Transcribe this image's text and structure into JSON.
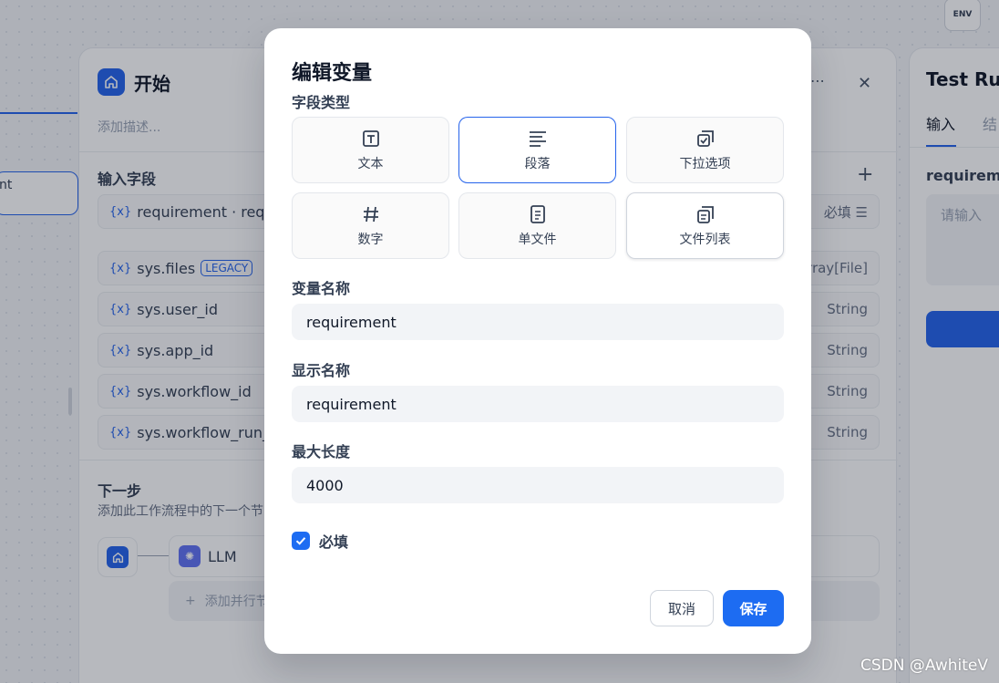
{
  "background": {
    "env_button": "ENV",
    "left_node_label": "nt",
    "start_panel": {
      "title": "开始",
      "description_placeholder": "添加描述...",
      "input_fields_label": "输入字段",
      "variables": [
        {
          "name": "requirement · requi",
          "right": "必填",
          "legacy": ""
        },
        {
          "name": "sys.files",
          "right": "rray[File]",
          "legacy": "LEGACY"
        },
        {
          "name": "sys.user_id",
          "right": "String",
          "legacy": ""
        },
        {
          "name": "sys.app_id",
          "right": "String",
          "legacy": ""
        },
        {
          "name": "sys.workflow_id",
          "right": "String",
          "legacy": ""
        },
        {
          "name": "sys.workflow_run_id",
          "right": "String",
          "legacy": ""
        }
      ],
      "variable_prefix": "{x}",
      "next_step_label": "下一步",
      "next_step_desc": "添加此工作流程中的下一个节",
      "llm_node": "LLM",
      "add_parallel": "添加并行节"
    },
    "test_run": {
      "title": "Test Run",
      "tab_input": "输入",
      "tab_result": "结",
      "field_label": "requirement",
      "input_placeholder": "请输入"
    }
  },
  "modal": {
    "title": "编辑变量",
    "field_type_label": "字段类型",
    "field_types": [
      {
        "label": "文本",
        "icon": "text-icon",
        "selected": false
      },
      {
        "label": "段落",
        "icon": "paragraph-icon",
        "selected": true
      },
      {
        "label": "下拉选项",
        "icon": "select-icon",
        "selected": false
      },
      {
        "label": "数字",
        "icon": "number-icon",
        "selected": false
      },
      {
        "label": "单文件",
        "icon": "file-icon",
        "selected": false
      },
      {
        "label": "文件列表",
        "icon": "file-list-icon",
        "selected": false
      }
    ],
    "variable_name_label": "变量名称",
    "variable_name_value": "requirement",
    "display_name_label": "显示名称",
    "display_name_value": "requirement",
    "max_length_label": "最大长度",
    "max_length_value": "4000",
    "required_label": "必填",
    "required_checked": true,
    "cancel_label": "取消",
    "save_label": "保存"
  },
  "watermark": "CSDN @AwhiteV",
  "colors": {
    "accent": "#1d6cf2",
    "border_selected": "#2563eb"
  }
}
